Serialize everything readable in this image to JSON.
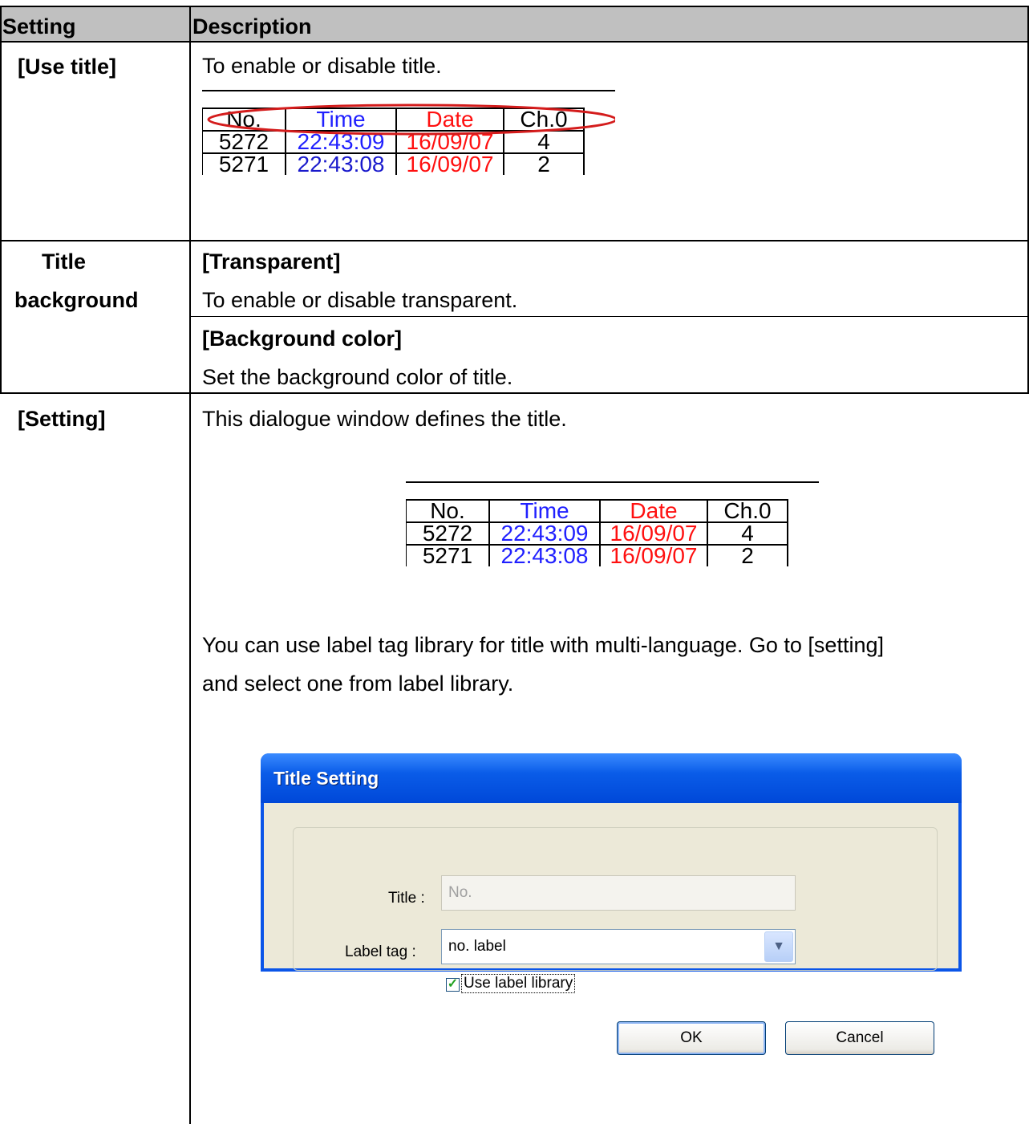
{
  "header": {
    "col1": "Setting",
    "col2": "Description"
  },
  "rows": [
    {
      "setting": "[Use title]",
      "description": "To enable or disable title."
    },
    {
      "setting_line1": "Title",
      "setting_line2": "background",
      "sub1_heading": "[Transparent]",
      "sub1_text": "To enable or disable transparent.",
      "sub2_heading": "[Background color]",
      "sub2_text": "Set the background color of title."
    },
    {
      "setting": "[Setting]",
      "description": "This dialogue window defines the title.",
      "para_line1": "You can use label tag library for title with multi-language. Go to [setting]",
      "para_line2": "and select one from label library."
    }
  ],
  "sample_table": {
    "headers": [
      "No.",
      "Time",
      "Date",
      "Ch.0"
    ],
    "rows": [
      [
        "5272",
        "22:43:09",
        "16/09/07",
        "4"
      ],
      [
        "5271",
        "22:43:08",
        "16/09/07",
        "2"
      ]
    ],
    "colors": {
      "time": "#2020ff",
      "date": "#ff1010",
      "highlight": "#d41c1c"
    }
  },
  "dialog": {
    "title": "Title Setting",
    "title_label": "Title :",
    "title_value": "No.",
    "label_tag_label": "Label tag :",
    "label_tag_value": "no. label",
    "use_library_label": "Use label library",
    "use_library_checked": true,
    "ok": "OK",
    "cancel": "Cancel"
  }
}
